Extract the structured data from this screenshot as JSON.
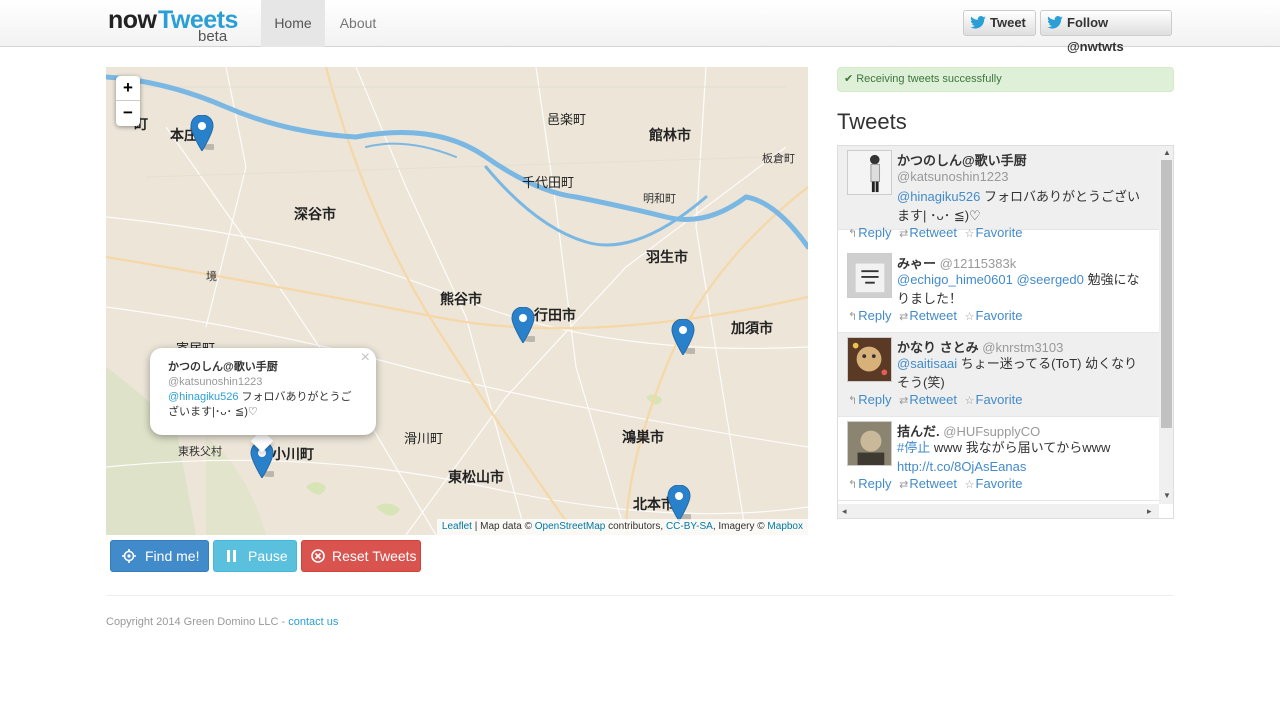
{
  "nav": {
    "brand_now": "now",
    "brand_tweets": "Tweets",
    "brand_beta": "beta",
    "home": "Home",
    "about": "About",
    "tweet_button": "Tweet",
    "follow_button": "Follow @nwtwts"
  },
  "map": {
    "zoom_in": "+",
    "zoom_out": "−",
    "labels": {
      "honjo": "本庄",
      "machi_top": "町",
      "oragomachi": "邑楽町",
      "tatebayashi": "館林市",
      "itakuramachi": "板倉町",
      "chiyodamachi": "千代田町",
      "meiwamachi": "明和町",
      "fukaya": "深谷市",
      "hanyu": "羽生市",
      "kumagaya": "熊谷市",
      "gyoda": "行田市",
      "kazo": "加須市",
      "yorii": "寄居町",
      "namegawa": "滑川町",
      "ogawa": "小川町",
      "konosu": "鴻巣市",
      "higashichichibu": "東秩父村",
      "higashimatsuyama": "東松山市",
      "kitamoto": "北本市",
      "sakai": "境"
    },
    "popup": {
      "close": "×",
      "name": "かつのしん@歌い手厨",
      "handle": "@katsunoshin1223",
      "mention": "@hinagiku526",
      "text": " フォロバありがとうございます|･ᴗ･ ≦)♡"
    },
    "attribution": {
      "leaflet": "Leaflet",
      "sep1": " | Map data © ",
      "osm": "OpenStreetMap",
      "contributors": " contributors, ",
      "license": "CC-BY-SA",
      "imagery": ", Imagery © ",
      "mapbox": "Mapbox"
    }
  },
  "buttons": {
    "find": "Find me!",
    "pause": "Pause",
    "reset": "Reset Tweets"
  },
  "status": {
    "check": "✔",
    "message": "Receiving tweets successfully"
  },
  "tweets_title": "Tweets",
  "tweets": [
    {
      "name": "かつのしん@歌い手厨",
      "handle": "@katsunoshin1223",
      "mention": "@hinagiku526",
      "text": " フォロバありがとうございます| ･ᴗ･ ≦)♡"
    },
    {
      "name": "みゃー",
      "handle": "@12115383k",
      "mention": "@echigo_hime0601",
      "mention2": "@seerged0",
      "text": " 勉強になりました！"
    },
    {
      "name": "かなり さとみ",
      "handle": "@knrstm3103",
      "mention": "@saitisaai",
      "text": " ちょー迷ってる(ToT) 幼くなりそう(笑)"
    },
    {
      "name": "拮んだ.",
      "handle": "@HUFsupplyCO",
      "hashtag": "#停止",
      "text": " www 我ながら届いてからwww",
      "link": "http://t.co/8OjAsEanas"
    }
  ],
  "tweet_actions": {
    "reply": "Reply",
    "retweet": "Retweet",
    "favorite": "Favorite"
  },
  "footer": {
    "copyright": "Copyright 2014 Green Domino LLC - ",
    "contact": "contact us"
  },
  "colors": {
    "brand_blue": "#2a9fd6",
    "primary": "#428bca",
    "info": "#5bc0de",
    "danger": "#d9534f",
    "success_bg": "#dff0d8",
    "marker": "#2a81cb",
    "river": "#7ab8e3"
  }
}
